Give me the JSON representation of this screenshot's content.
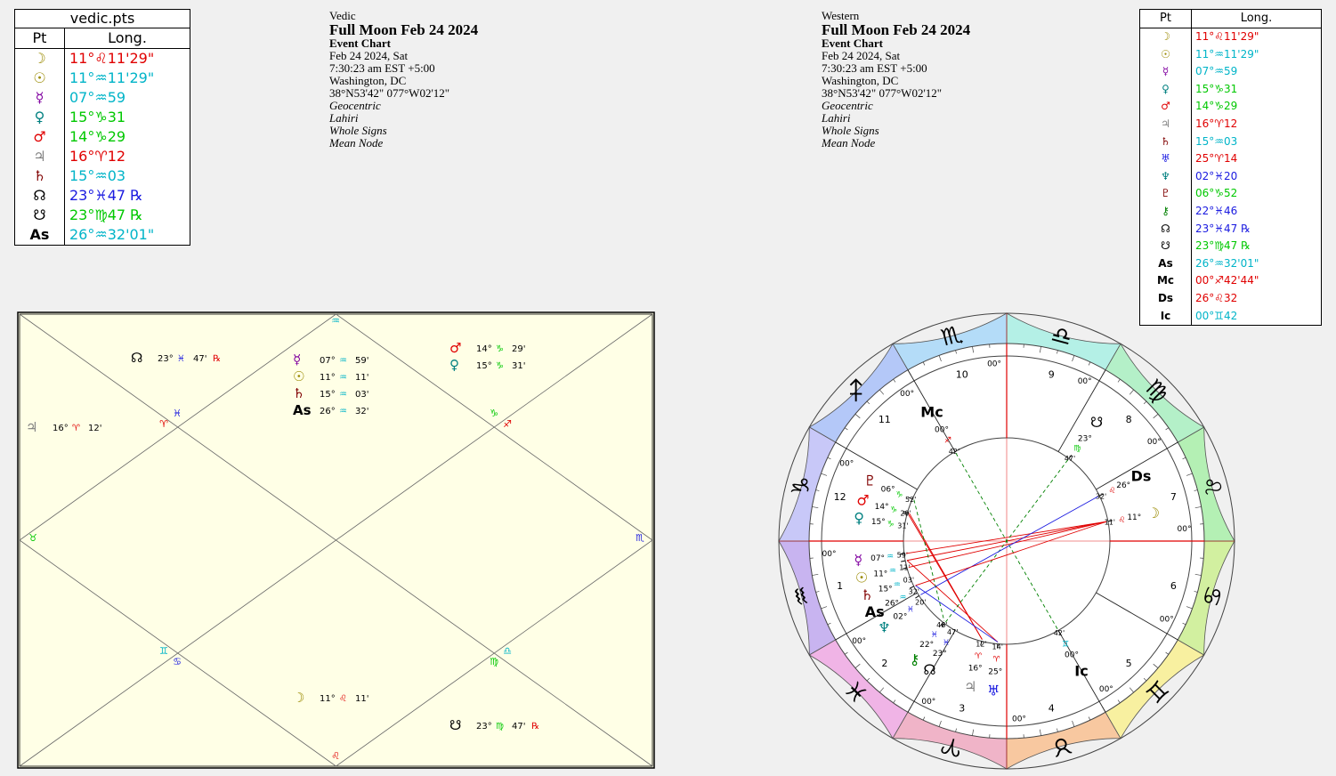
{
  "vedic_table": {
    "title": "vedic.pts",
    "col_pt": "Pt",
    "col_long": "Long.",
    "rows": [
      {
        "glyph": "☽",
        "glyph_color": "#9a8a00",
        "long": "11°♌11'29\"",
        "color": "#e00000",
        "icon": "moon-icon"
      },
      {
        "glyph": "☉",
        "glyph_color": "#9a8a00",
        "long": "11°♒11'29\"",
        "color": "#00b4c8",
        "icon": "sun-icon"
      },
      {
        "glyph": "☿",
        "glyph_color": "#8000a0",
        "long": "07°♒59",
        "color": "#00b4c8",
        "icon": "mercury-icon"
      },
      {
        "glyph": "♀",
        "glyph_color": "#008080",
        "long": "15°♑31",
        "color": "#00c800",
        "icon": "venus-icon"
      },
      {
        "glyph": "♂",
        "glyph_color": "#e00000",
        "long": "14°♑29",
        "color": "#00c800",
        "icon": "mars-icon"
      },
      {
        "glyph": "♃",
        "glyph_color": "#808080",
        "long": "16°♈12",
        "color": "#e00000",
        "icon": "jupiter-icon"
      },
      {
        "glyph": "♄",
        "glyph_color": "#800000",
        "long": "15°♒03",
        "color": "#00b4c8",
        "icon": "saturn-icon"
      },
      {
        "glyph": "☊",
        "glyph_color": "#000000",
        "long": "23°♓47 ℞",
        "color": "#1a1ae0",
        "icon": "north-node-icon"
      },
      {
        "glyph": "☋",
        "glyph_color": "#000000",
        "long": "23°♍47 ℞",
        "color": "#00c800",
        "icon": "south-node-icon"
      },
      {
        "glyph": "As",
        "glyph_color": "#000000",
        "long": "26°♒32'01\"",
        "color": "#00b4c8",
        "icon": "ascendant-icon"
      }
    ]
  },
  "vedic_info": {
    "system": "Vedic",
    "title": "Full Moon Feb 24 2024",
    "chart_type": "Event Chart",
    "date": "Feb 24 2024, Sat",
    "time": "7:30:23 am  EST +5:00",
    "place": "Washington, DC",
    "coords": "38°N53'42\" 077°W02'12\"",
    "center": "Geocentric",
    "ayanamsa": "Lahiri",
    "houses": "Whole Signs",
    "node": "Mean Node"
  },
  "western_info": {
    "system": "Western",
    "title": "Full Moon Feb 24 2024",
    "chart_type": "Event Chart",
    "date": "Feb 24 2024, Sat",
    "time": "7:30:23 am  EST +5:00",
    "place": "Washington, DC",
    "coords": "38°N53'42\" 077°W02'12\"",
    "center": "Geocentric",
    "ayanamsa": "Lahiri",
    "houses": "Whole Signs",
    "node": "Mean Node"
  },
  "western_table": {
    "col_pt": "Pt",
    "col_long": "Long.",
    "rows": [
      {
        "glyph": "☽",
        "glyph_color": "#9a8a00",
        "long": "11°♌11'29\"",
        "color": "#e00000",
        "icon": "moon-icon"
      },
      {
        "glyph": "☉",
        "glyph_color": "#9a8a00",
        "long": "11°♒11'29\"",
        "color": "#00b4c8",
        "icon": "sun-icon"
      },
      {
        "glyph": "☿",
        "glyph_color": "#8000a0",
        "long": "07°♒59",
        "color": "#00b4c8",
        "icon": "mercury-icon"
      },
      {
        "glyph": "♀",
        "glyph_color": "#008080",
        "long": "15°♑31",
        "color": "#00c800",
        "icon": "venus-icon"
      },
      {
        "glyph": "♂",
        "glyph_color": "#e00000",
        "long": "14°♑29",
        "color": "#00c800",
        "icon": "mars-icon"
      },
      {
        "glyph": "♃",
        "glyph_color": "#808080",
        "long": "16°♈12",
        "color": "#e00000",
        "icon": "jupiter-icon"
      },
      {
        "glyph": "♄",
        "glyph_color": "#800000",
        "long": "15°♒03",
        "color": "#00b4c8",
        "icon": "saturn-icon"
      },
      {
        "glyph": "♅",
        "glyph_color": "#1a1ae0",
        "long": "25°♈14",
        "color": "#e00000",
        "icon": "uranus-icon"
      },
      {
        "glyph": "♆",
        "glyph_color": "#008080",
        "long": "02°♓20",
        "color": "#1a1ae0",
        "icon": "neptune-icon"
      },
      {
        "glyph": "♇",
        "glyph_color": "#800000",
        "long": "06°♑52",
        "color": "#00c800",
        "icon": "pluto-icon"
      },
      {
        "glyph": "⚷",
        "glyph_color": "#008000",
        "long": "22°♓46",
        "color": "#1a1ae0",
        "icon": "chiron-icon"
      },
      {
        "glyph": "☊",
        "glyph_color": "#000000",
        "long": "23°♓47 ℞",
        "color": "#1a1ae0",
        "icon": "north-node-icon"
      },
      {
        "glyph": "☋",
        "glyph_color": "#000000",
        "long": "23°♍47 ℞",
        "color": "#00c800",
        "icon": "south-node-icon"
      },
      {
        "glyph": "As",
        "glyph_color": "#000000",
        "long": "26°♒32'01\"",
        "color": "#00b4c8",
        "icon": "ascendant-icon"
      },
      {
        "glyph": "Mc",
        "glyph_color": "#000000",
        "long": "00°♐42'44\"",
        "color": "#e00000",
        "icon": "midheaven-icon"
      },
      {
        "glyph": "Ds",
        "glyph_color": "#000000",
        "long": "26°♌32",
        "color": "#e00000",
        "icon": "descendant-icon"
      },
      {
        "glyph": "Ic",
        "glyph_color": "#000000",
        "long": "00°♊42",
        "color": "#00b4c8",
        "icon": "imum-coeli-icon"
      }
    ]
  },
  "vedic_chart": {
    "sign_markers": {
      "h1": {
        "sign": "♒",
        "color": "#00b4c8"
      },
      "h2_a": {
        "sign": "♓",
        "color": "#1a1ae0"
      },
      "h2_b": {
        "sign": "♈",
        "color": "#e00000"
      },
      "h3": {
        "sign": "♉",
        "color": "#00c800"
      },
      "h4_a": {
        "sign": "♊",
        "color": "#00b4c8"
      },
      "h4_b": {
        "sign": "♋",
        "color": "#1a1ae0"
      },
      "h5": {
        "sign": "♌",
        "color": "#e00000"
      },
      "h6_a": {
        "sign": "♍",
        "color": "#00c800"
      },
      "h6_b": {
        "sign": "♎",
        "color": "#00b4c8"
      },
      "h7": {
        "sign": "♏",
        "color": "#1a1ae0"
      },
      "h8_a": {
        "sign": "♐",
        "color": "#e00000"
      },
      "h8_b": {
        "sign": "♑",
        "color": "#00c800"
      }
    },
    "placements": [
      {
        "glyph": "☊",
        "gcolor": "#000000",
        "deg": "23°",
        "sign": "♓",
        "scolor": "#1a1ae0",
        "min": "47'",
        "retro": "℞",
        "icon": "north-node-icon"
      },
      {
        "glyph": "♃",
        "gcolor": "#808080",
        "deg": "16°",
        "sign": "♈",
        "scolor": "#e00000",
        "min": "12'",
        "retro": "",
        "icon": "jupiter-icon"
      },
      {
        "glyph": "☿",
        "gcolor": "#8000a0",
        "deg": "07°",
        "sign": "♒",
        "scolor": "#00b4c8",
        "min": "59'",
        "retro": "",
        "icon": "mercury-icon"
      },
      {
        "glyph": "☉",
        "gcolor": "#9a8a00",
        "deg": "11°",
        "sign": "♒",
        "scolor": "#00b4c8",
        "min": "11'",
        "retro": "",
        "icon": "sun-icon"
      },
      {
        "glyph": "♄",
        "gcolor": "#800000",
        "deg": "15°",
        "sign": "♒",
        "scolor": "#00b4c8",
        "min": "03'",
        "retro": "",
        "icon": "saturn-icon"
      },
      {
        "glyph": "As",
        "gcolor": "#000000",
        "deg": "26°",
        "sign": "♒",
        "scolor": "#00b4c8",
        "min": "32'",
        "retro": "",
        "icon": "ascendant-icon"
      },
      {
        "glyph": "♂",
        "gcolor": "#e00000",
        "deg": "14°",
        "sign": "♑",
        "scolor": "#00c800",
        "min": "29'",
        "retro": "",
        "icon": "mars-icon"
      },
      {
        "glyph": "♀",
        "gcolor": "#008080",
        "deg": "15°",
        "sign": "♑",
        "scolor": "#00c800",
        "min": "31'",
        "retro": "",
        "icon": "venus-icon"
      },
      {
        "glyph": "☽",
        "gcolor": "#9a8a00",
        "deg": "11°",
        "sign": "♌",
        "scolor": "#e00000",
        "min": "11'",
        "retro": "",
        "icon": "moon-icon"
      },
      {
        "glyph": "☋",
        "gcolor": "#000000",
        "deg": "23°",
        "sign": "♍",
        "scolor": "#00c800",
        "min": "47'",
        "retro": "℞",
        "icon": "south-node-icon"
      }
    ]
  },
  "western_wheel": {
    "cusp_degree_label": "00°",
    "angle_minutes_label": "42'",
    "houses": [
      "1",
      "2",
      "3",
      "4",
      "5",
      "6",
      "7",
      "8",
      "9",
      "10",
      "11",
      "12"
    ],
    "signs": [
      {
        "glyph": "♒",
        "color": "#c8b4f0",
        "icon": "aquarius-icon"
      },
      {
        "glyph": "♓",
        "color": "#f0b4e6",
        "icon": "pisces-icon"
      },
      {
        "glyph": "♈",
        "color": "#f0b4c8",
        "icon": "aries-icon"
      },
      {
        "glyph": "♉",
        "color": "#f8c8a0",
        "icon": "taurus-icon"
      },
      {
        "glyph": "♊",
        "color": "#f8f0a0",
        "icon": "gemini-icon"
      },
      {
        "glyph": "♋",
        "color": "#d2f0a0",
        "icon": "cancer-icon"
      },
      {
        "glyph": "♌",
        "color": "#b4f0b4",
        "icon": "leo-icon"
      },
      {
        "glyph": "♍",
        "color": "#b4f0c8",
        "icon": "virgo-icon"
      },
      {
        "glyph": "♎",
        "color": "#b4f0e6",
        "icon": "libra-icon"
      },
      {
        "glyph": "♏",
        "color": "#b4dcf8",
        "icon": "scorpio-icon"
      },
      {
        "glyph": "♐",
        "color": "#b4c8f8",
        "icon": "sagittarius-icon"
      },
      {
        "glyph": "♑",
        "color": "#c8c8f8",
        "icon": "capricorn-icon"
      }
    ],
    "planets": [
      {
        "glyph": "Mc",
        "gcolor": "#000000",
        "deg": "00°",
        "sign": "♐",
        "scolor": "#e00000",
        "min": "42'",
        "icon": "midheaven-icon"
      },
      {
        "glyph": "☋",
        "gcolor": "#000000",
        "deg": "23°",
        "sign": "♍",
        "scolor": "#00c800",
        "min": "47'",
        "icon": "south-node-icon"
      },
      {
        "glyph": "Ds",
        "gcolor": "#000000",
        "deg": "26°",
        "sign": "♌",
        "scolor": "#e00000",
        "min": "32'",
        "icon": "descendant-icon"
      },
      {
        "glyph": "☽",
        "gcolor": "#9a8a00",
        "deg": "11°",
        "sign": "♌",
        "scolor": "#e00000",
        "min": "11'",
        "icon": "moon-icon"
      },
      {
        "glyph": "♇",
        "gcolor": "#800000",
        "deg": "06°",
        "sign": "♑",
        "scolor": "#00c800",
        "min": "52'",
        "icon": "pluto-icon"
      },
      {
        "glyph": "♂",
        "gcolor": "#e00000",
        "deg": "14°",
        "sign": "♑",
        "scolor": "#00c800",
        "min": "29'",
        "icon": "mars-icon"
      },
      {
        "glyph": "♀",
        "gcolor": "#008080",
        "deg": "15°",
        "sign": "♑",
        "scolor": "#00c800",
        "min": "31'",
        "icon": "venus-icon"
      },
      {
        "glyph": "☿",
        "gcolor": "#8000a0",
        "deg": "07°",
        "sign": "♒",
        "scolor": "#00b4c8",
        "min": "59'",
        "icon": "mercury-icon"
      },
      {
        "glyph": "☉",
        "gcolor": "#9a8a00",
        "deg": "11°",
        "sign": "♒",
        "scolor": "#00b4c8",
        "min": "11'",
        "icon": "sun-icon"
      },
      {
        "glyph": "♄",
        "gcolor": "#800000",
        "deg": "15°",
        "sign": "♒",
        "scolor": "#00b4c8",
        "min": "03'",
        "icon": "saturn-icon"
      },
      {
        "glyph": "As",
        "gcolor": "#000000",
        "deg": "26°",
        "sign": "♒",
        "scolor": "#00b4c8",
        "min": "32'",
        "icon": "ascendant-icon"
      },
      {
        "glyph": "♆",
        "gcolor": "#008080",
        "deg": "02°",
        "sign": "♓",
        "scolor": "#1a1ae0",
        "min": "20'",
        "icon": "neptune-icon"
      },
      {
        "glyph": "⚷",
        "gcolor": "#008000",
        "deg": "22°",
        "sign": "♓",
        "scolor": "#1a1ae0",
        "min": "46'",
        "icon": "chiron-icon"
      },
      {
        "glyph": "☊",
        "gcolor": "#000000",
        "deg": "23°",
        "sign": "♓",
        "scolor": "#1a1ae0",
        "min": "47'",
        "icon": "north-node-icon"
      },
      {
        "glyph": "♃",
        "gcolor": "#808080",
        "deg": "16°",
        "sign": "♈",
        "scolor": "#e00000",
        "min": "12'",
        "icon": "jupiter-icon"
      },
      {
        "glyph": "♅",
        "gcolor": "#1a1ae0",
        "deg": "25°",
        "sign": "♈",
        "scolor": "#e00000",
        "min": "14'",
        "icon": "uranus-icon"
      },
      {
        "glyph": "Ic",
        "gcolor": "#000000",
        "deg": "00°",
        "sign": "♊",
        "scolor": "#00b4c8",
        "min": "42'",
        "icon": "imum-coeli-icon"
      }
    ]
  }
}
